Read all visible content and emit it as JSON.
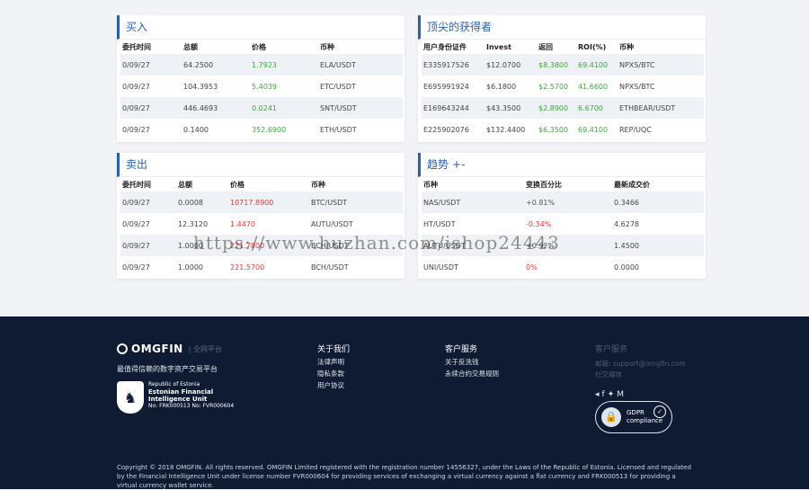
{
  "buy": {
    "title": "买入",
    "headers": [
      "委托时间",
      "总额",
      "价格",
      "币种"
    ],
    "rows": [
      [
        "0/09/27",
        "64.2500",
        "1.7923",
        "ELA/USDT"
      ],
      [
        "0/09/27",
        "104.3953",
        "5.4039",
        "ETC/USDT"
      ],
      [
        "0/09/27",
        "446.4693",
        "0.0241",
        "SNT/USDT"
      ],
      [
        "0/09/27",
        "0.1400",
        "352.6900",
        "ETH/USDT"
      ]
    ]
  },
  "top_winners": {
    "title": "顶尖的获得者",
    "headers": [
      "用户身份证件",
      "Invest",
      "返回",
      "ROI(%)",
      "币种"
    ],
    "rows": [
      [
        "E335917526",
        "$12.0700",
        "$8.3800",
        "69.4100",
        "NPXS/BTC"
      ],
      [
        "E695991924",
        "$6.1800",
        "$2.5700",
        "41.6600",
        "NPXS/BTC"
      ],
      [
        "E169643244",
        "$43.3500",
        "$2.8900",
        "6.6700",
        "ETHBEAR/USDT"
      ],
      [
        "E225902076",
        "$132.4400",
        "$6.3500",
        "69.4100",
        "REP/UQC"
      ]
    ]
  },
  "sell": {
    "title": "卖出",
    "headers": [
      "委托时间",
      "总额",
      "价格",
      "币种"
    ],
    "rows": [
      [
        "0/09/27",
        "0.0008",
        "10717.8900",
        "BTC/USDT"
      ],
      [
        "0/09/27",
        "12.3120",
        "1.4470",
        "AUTU/USDT"
      ],
      [
        "0/09/27",
        "1.0000",
        "221.7800",
        "BCH/USDT"
      ],
      [
        "0/09/27",
        "1.0000",
        "221.5700",
        "BCH/USDT"
      ]
    ]
  },
  "trend": {
    "title": "趋势",
    "title_suffix": "+-",
    "headers": [
      "币种",
      "变换百分比",
      "最新成交价"
    ],
    "rows": [
      [
        "NAS/USDT",
        "+0.81%",
        "0.3466"
      ],
      [
        "HT/USDT",
        "-0.34%",
        "4.6278"
      ],
      [
        "AUTU/USDT",
        "+0.92%",
        "1.4500"
      ],
      [
        "UNI/USDT",
        "0%",
        "0.0000"
      ]
    ]
  },
  "watermark": "https://www.huzhan.com/ishop24443",
  "footer": {
    "logo_text": "OMGFIN",
    "logo_suffix": "| 全网平台",
    "tagline": "最值得信赖的数字资产交易平台",
    "seal_line1": "Republic of Estonia",
    "seal_line2": "Estonian Financial",
    "seal_line3": "Intelligence Unit",
    "seal_line4": "No: FRK000513 No: FVR000604",
    "about": {
      "title": "关于我们",
      "links": [
        "法律声明",
        "隐私条款",
        "用户协议"
      ]
    },
    "service": {
      "title": "客户服务",
      "links": [
        "关于反洗钱",
        "永续合约交易规则"
      ]
    },
    "contact": {
      "title": "客户服务",
      "email": "邮箱: support@omgfin.com",
      "social": "社交媒体"
    },
    "gdpr": {
      "line1": "GDPR",
      "line2": "compliance"
    },
    "copyright": "Copyright © 2018 OMGFIN. All rights reserved. OMGFIN Limited registered with the registration number 14556327, under the Laws of the Republic of Estonia. Licensed and regulated by the Financial Intelligence Unit under license number FVR000604 for providing services of exchanging a virtual currency against a flat currency and FRK000513 for providing a virtual currency wallet service."
  }
}
